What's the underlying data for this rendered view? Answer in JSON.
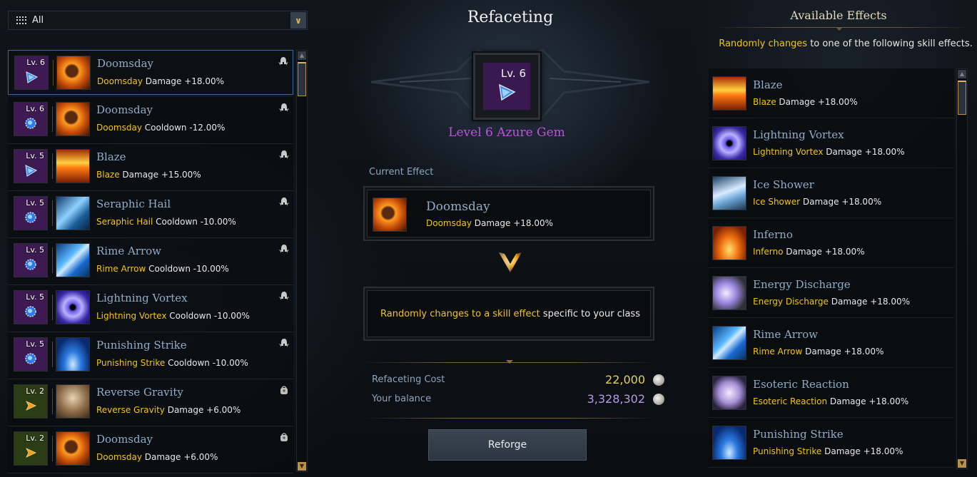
{
  "filter": {
    "label": "All",
    "icon": "grid-icon",
    "dropdown_icon": "chevron-down-icon"
  },
  "gem_list": [
    {
      "level": "Lv. 6",
      "gem_color": "purple",
      "gem_type": "damage",
      "skill": "Doomsday",
      "name": "Doomsday",
      "effect_skill": "Doomsday",
      "effect_rest": " Damage +18.00%",
      "mark": "helmet-icon",
      "selected": true
    },
    {
      "level": "Lv. 6",
      "gem_color": "purple",
      "gem_type": "cooldown",
      "skill": "Doomsday",
      "name": "Doomsday",
      "effect_skill": "Doomsday",
      "effect_rest": " Cooldown -12.00%",
      "mark": "helmet-icon",
      "selected": false
    },
    {
      "level": "Lv. 5",
      "gem_color": "purple",
      "gem_type": "damage",
      "skill": "Blaze",
      "name": "Blaze",
      "effect_skill": "Blaze",
      "effect_rest": " Damage +15.00%",
      "mark": "helmet-icon",
      "selected": false
    },
    {
      "level": "Lv. 5",
      "gem_color": "purple",
      "gem_type": "cooldown",
      "skill": "Seraphic Hail",
      "name": "Seraphic Hail",
      "effect_skill": "Seraphic Hail",
      "effect_rest": " Cooldown -10.00%",
      "mark": "helmet-icon",
      "selected": false
    },
    {
      "level": "Lv. 5",
      "gem_color": "purple",
      "gem_type": "cooldown",
      "skill": "Rime Arrow",
      "name": "Rime Arrow",
      "effect_skill": "Rime Arrow",
      "effect_rest": " Cooldown -10.00%",
      "mark": "helmet-icon",
      "selected": false
    },
    {
      "level": "Lv. 5",
      "gem_color": "purple",
      "gem_type": "cooldown",
      "skill": "Lightning Vortex",
      "name": "Lightning Vortex",
      "effect_skill": "Lightning Vortex",
      "effect_rest": " Cooldown -10.00%",
      "mark": "helmet-icon",
      "selected": false
    },
    {
      "level": "Lv. 5",
      "gem_color": "purple",
      "gem_type": "cooldown",
      "skill": "Punishing Strike",
      "name": "Punishing Strike",
      "effect_skill": "Punishing Strike",
      "effect_rest": " Cooldown -10.00%",
      "mark": "helmet-icon",
      "selected": false
    },
    {
      "level": "Lv. 2",
      "gem_color": "green",
      "gem_type": "damage",
      "skill": "Reverse Gravity",
      "name": "Reverse Gravity",
      "effect_skill": "Reverse Gravity",
      "effect_rest": " Damage +6.00%",
      "mark": "bag-icon",
      "selected": false
    },
    {
      "level": "Lv. 2",
      "gem_color": "green",
      "gem_type": "damage",
      "skill": "Doomsday",
      "name": "Doomsday",
      "effect_skill": "Doomsday",
      "effect_rest": " Damage +6.00%",
      "mark": "bag-icon",
      "selected": false
    }
  ],
  "center": {
    "title": "Refaceting",
    "gem_level": "Lv. 6",
    "gem_name": "Level 6 Azure Gem",
    "current_effect_label": "Current Effect",
    "current_effect": {
      "skill": "Doomsday",
      "name": "Doomsday",
      "effect_skill": "Doomsday",
      "effect_rest": " Damage +18.00%"
    },
    "random_gold": "Randomly changes to a skill effect",
    "random_rest": " specific to your class",
    "cost_label": "Refaceting Cost",
    "cost_value": "22,000",
    "balance_label": "Your balance",
    "balance_value": "3,328,302",
    "reforge_label": "Reforge"
  },
  "right": {
    "title": "Available Effects",
    "info_gold": "Randomly changes",
    "info_rest": " to one of the following skill effects.",
    "effects": [
      {
        "skill": "Blaze",
        "name": "Blaze",
        "effect_skill": "Blaze",
        "effect_rest": " Damage +18.00%"
      },
      {
        "skill": "Lightning Vortex",
        "name": "Lightning Vortex",
        "effect_skill": "Lightning Vortex",
        "effect_rest": " Damage +18.00%"
      },
      {
        "skill": "Ice Shower",
        "name": "Ice Shower",
        "effect_skill": "Ice Shower",
        "effect_rest": " Damage +18.00%"
      },
      {
        "skill": "Inferno",
        "name": "Inferno",
        "effect_skill": "Inferno",
        "effect_rest": " Damage +18.00%"
      },
      {
        "skill": "Energy Discharge",
        "name": "Energy Discharge",
        "effect_skill": "Energy Discharge",
        "effect_rest": " Damage +18.00%"
      },
      {
        "skill": "Rime Arrow",
        "name": "Rime Arrow",
        "effect_skill": "Rime Arrow",
        "effect_rest": " Damage +18.00%"
      },
      {
        "skill": "Esoteric Reaction",
        "name": "Esoteric Reaction",
        "effect_skill": "Esoteric Reaction",
        "effect_rest": " Damage +18.00%"
      },
      {
        "skill": "Punishing Strike",
        "name": "Punishing Strike",
        "effect_skill": "Punishing Strike",
        "effect_rest": " Damage +18.00%"
      }
    ]
  },
  "colors": {
    "gold_text": "#f0c419",
    "skill_name": "#8fadc8",
    "gem_name": "#c24fe2",
    "cost_value": "#e6d44a",
    "balance_value": "#b49be8",
    "selected_border": "#3b6b96"
  }
}
